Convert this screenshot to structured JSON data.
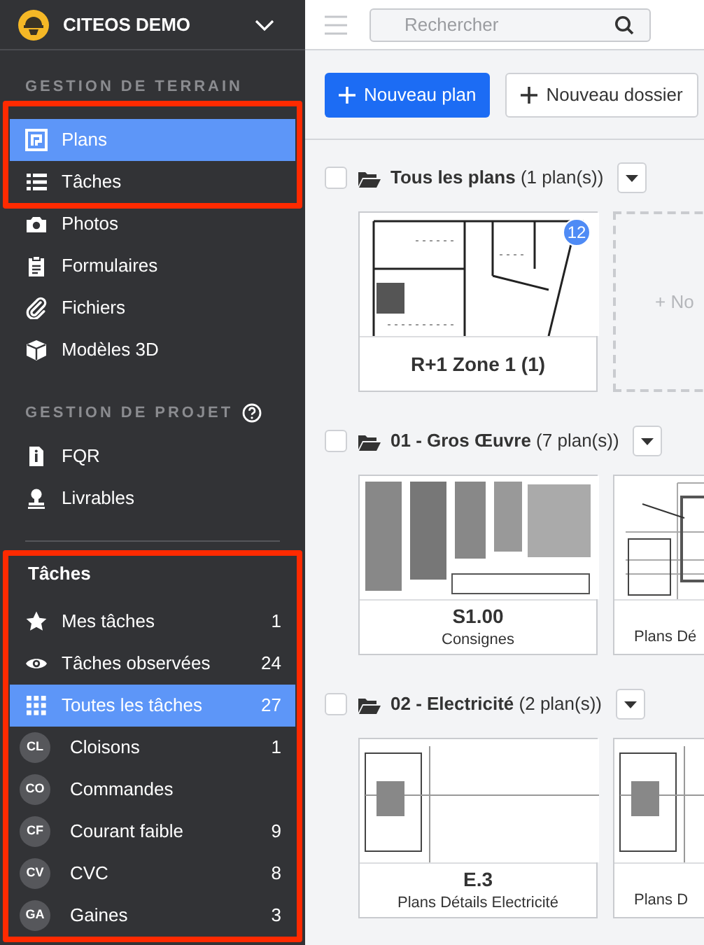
{
  "workspace": {
    "name": "CITEOS DEMO"
  },
  "sidebar": {
    "sections": [
      {
        "title": "GESTION DE TERRAIN",
        "help": false,
        "items": [
          {
            "label": "Plans",
            "selected": true,
            "highlighted": true
          },
          {
            "label": "Tâches",
            "selected": false,
            "highlighted": true
          },
          {
            "label": "Photos",
            "selected": false,
            "highlighted": false
          },
          {
            "label": "Formulaires",
            "selected": false,
            "highlighted": false
          },
          {
            "label": "Fichiers",
            "selected": false,
            "highlighted": false
          },
          {
            "label": "Modèles 3D",
            "selected": false,
            "highlighted": false
          }
        ]
      },
      {
        "title": "GESTION DE PROJET",
        "help": true,
        "items": [
          {
            "label": "FQR",
            "selected": false,
            "highlighted": false
          },
          {
            "label": "Livrables",
            "selected": false,
            "highlighted": false
          }
        ]
      }
    ]
  },
  "tasks_panel": {
    "title": "Tâches",
    "highlighted": true,
    "items": [
      {
        "kind": "filter",
        "label": "Mes tâches",
        "count": "1",
        "selected": false
      },
      {
        "kind": "filter",
        "label": "Tâches observées",
        "count": "24",
        "selected": false
      },
      {
        "kind": "filter",
        "label": "Toutes les tâches",
        "count": "27",
        "selected": true
      },
      {
        "kind": "category",
        "initials": "CL",
        "label": "Cloisons",
        "count": "1",
        "selected": false
      },
      {
        "kind": "category",
        "initials": "CO",
        "label": "Commandes",
        "selected": false
      },
      {
        "kind": "category",
        "initials": "CF",
        "label": "Courant faible",
        "count": "9",
        "selected": false
      },
      {
        "kind": "category",
        "initials": "CV",
        "label": "CVC",
        "count": "8",
        "selected": false
      },
      {
        "kind": "category",
        "initials": "GA",
        "label": "Gaines",
        "count": "3",
        "selected": false
      }
    ]
  },
  "search": {
    "placeholder": "Rechercher"
  },
  "actions": [
    {
      "label": "Nouveau plan",
      "primary": true
    },
    {
      "label": "Nouveau dossier",
      "primary": false
    }
  ],
  "folders": [
    {
      "name": "Tous les plans",
      "count": "(1 plan(s))",
      "checked": false,
      "cards": [
        {
          "kind": "plan",
          "title": "R+1 Zone 1 (1)",
          "badge": "12"
        },
        {
          "kind": "add",
          "label": "+ No"
        }
      ]
    },
    {
      "name": "01 - Gros Œuvre",
      "count": "(7 plan(s))",
      "checked": false,
      "cards": [
        {
          "kind": "plan",
          "title": "S1.00",
          "subtitle": "Consignes"
        },
        {
          "kind": "plan",
          "subtitle": "Plans Dé"
        }
      ]
    },
    {
      "name": "02 - Electricité",
      "count": "(2 plan(s))",
      "checked": false,
      "cards": [
        {
          "kind": "plan",
          "title": "E.3",
          "subtitle": "Plans Détails Electricité"
        },
        {
          "kind": "plan",
          "subtitle": "Plans D"
        }
      ]
    }
  ]
}
